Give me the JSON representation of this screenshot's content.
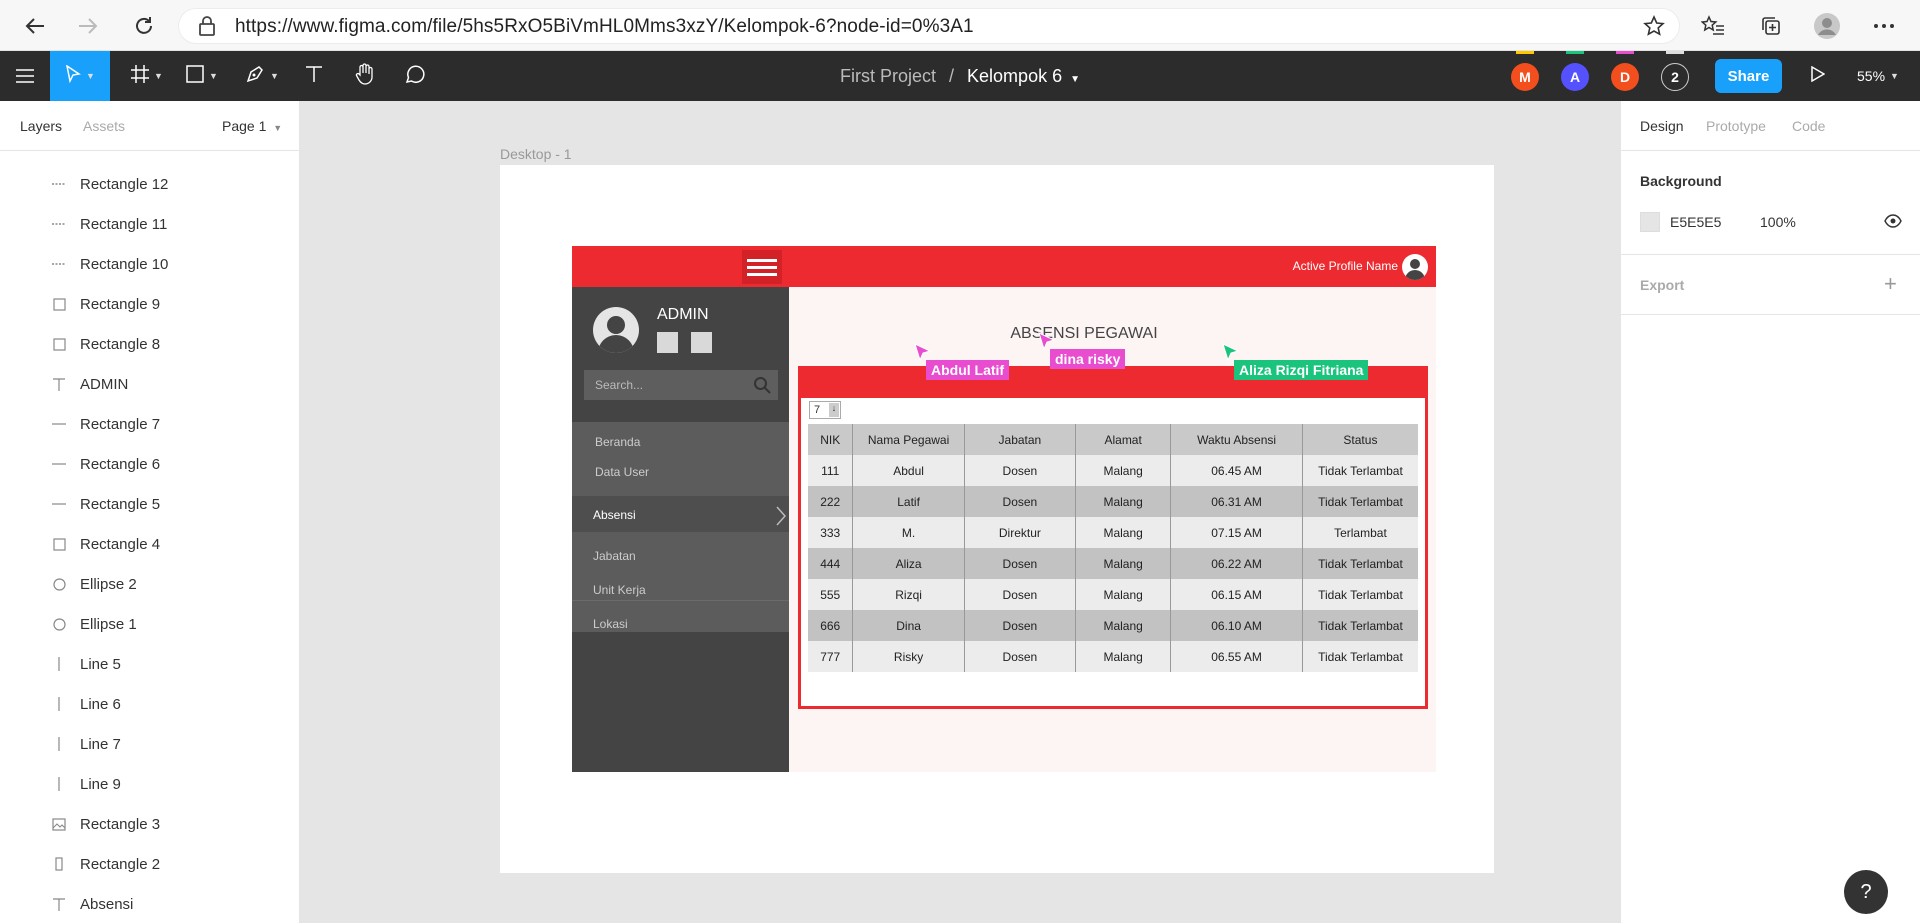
{
  "browser": {
    "url": "https://www.figma.com/file/5hs5RxO5BiVmHL0Mms3xzY/Kelompok-6?node-id=0%3A1"
  },
  "toolbar": {
    "project": "First Project",
    "separator": "/",
    "file": "Kelompok 6",
    "share_label": "Share",
    "zoom": "55%",
    "collaborators": [
      {
        "initial": "M",
        "color": "#f24e1e"
      },
      {
        "initial": "A",
        "color": "#5551ff"
      },
      {
        "initial": "D",
        "color": "#f24e1e"
      }
    ],
    "extra_count": "2"
  },
  "left_panel": {
    "tabs": {
      "layers": "Layers",
      "assets": "Assets"
    },
    "page": "Page 1",
    "layers": [
      {
        "name": "Rectangle 12",
        "icon": "dash-icon"
      },
      {
        "name": "Rectangle 11",
        "icon": "dash-icon"
      },
      {
        "name": "Rectangle 10",
        "icon": "dash-icon"
      },
      {
        "name": "Rectangle 9",
        "icon": "rectangle-icon"
      },
      {
        "name": "Rectangle 8",
        "icon": "rectangle-icon"
      },
      {
        "name": "ADMIN",
        "icon": "text-icon"
      },
      {
        "name": "Rectangle 7",
        "icon": "line-icon"
      },
      {
        "name": "Rectangle 6",
        "icon": "line-icon"
      },
      {
        "name": "Rectangle 5",
        "icon": "line-icon"
      },
      {
        "name": "Rectangle 4",
        "icon": "rectangle-icon"
      },
      {
        "name": "Ellipse 2",
        "icon": "ellipse-icon"
      },
      {
        "name": "Ellipse 1",
        "icon": "ellipse-icon"
      },
      {
        "name": "Line 5",
        "icon": "vertical-line-icon"
      },
      {
        "name": "Line 6",
        "icon": "vertical-line-icon"
      },
      {
        "name": "Line 7",
        "icon": "vertical-line-icon"
      },
      {
        "name": "Line 9",
        "icon": "vertical-line-icon"
      },
      {
        "name": "Rectangle 3",
        "icon": "image-icon"
      },
      {
        "name": "Rectangle 2",
        "icon": "tall-rectangle-icon"
      },
      {
        "name": "Absensi",
        "icon": "text-icon"
      }
    ]
  },
  "canvas": {
    "frame_label": "Desktop - 1",
    "design": {
      "profile_name": "Active Profile Name",
      "admin_label": "ADMIN",
      "search_placeholder": "Search...",
      "menu": [
        "Beranda",
        "Data User",
        "Absensi",
        "Jabatan",
        "Unit Kerja",
        "Lokasi"
      ],
      "active_menu": "Absensi",
      "title": "ABSENSI PEGAWAI",
      "page_size": "7",
      "table": {
        "headers": [
          "NIK",
          "Nama Pegawai",
          "Jabatan",
          "Alamat",
          "Waktu Absensi",
          "Status"
        ],
        "rows": [
          [
            "111",
            "Abdul",
            "Dosen",
            "Malang",
            "06.45 AM",
            "Tidak Terlambat"
          ],
          [
            "222",
            "Latif",
            "Dosen",
            "Malang",
            "06.31 AM",
            "Tidak Terlambat"
          ],
          [
            "333",
            "M.",
            "Direktur",
            "Malang",
            "07.15 AM",
            "Terlambat"
          ],
          [
            "444",
            "Aliza",
            "Dosen",
            "Malang",
            "06.22 AM",
            "Tidak Terlambat"
          ],
          [
            "555",
            "Rizqi",
            "Dosen",
            "Malang",
            "06.15 AM",
            "Tidak Terlambat"
          ],
          [
            "666",
            "Dina",
            "Dosen",
            "Malang",
            "06.10 AM",
            "Tidak Terlambat"
          ],
          [
            "777",
            "Risky",
            "Dosen",
            "Malang",
            "06.55 AM",
            "Tidak Terlambat"
          ]
        ]
      },
      "brand_color": "#ec2a2f"
    },
    "cursors": [
      {
        "name": "Abdul Latif",
        "color": "#e84ccf"
      },
      {
        "name": "dina risky",
        "color": "#e84ccf"
      },
      {
        "name": "Aliza Rizqi Fitriana",
        "color": "#1bc47d"
      }
    ]
  },
  "right_panel": {
    "tabs": {
      "design": "Design",
      "prototype": "Prototype",
      "code": "Code"
    },
    "background_label": "Background",
    "background_hex": "E5E5E5",
    "background_opacity": "100%",
    "export_label": "Export"
  },
  "help_label": "?"
}
